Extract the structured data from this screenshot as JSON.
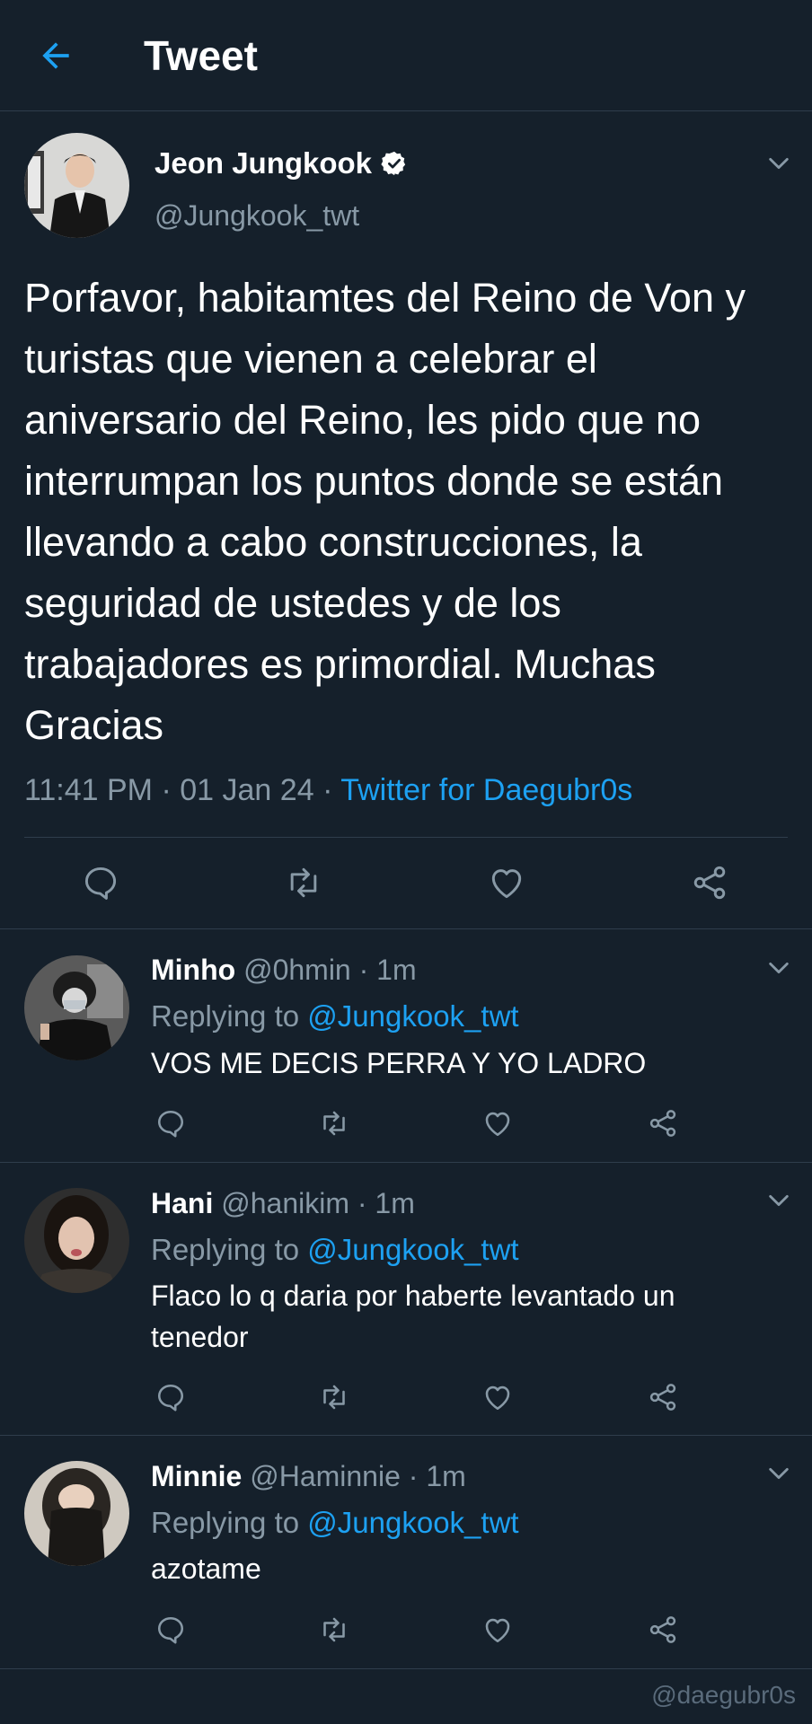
{
  "header": {
    "title": "Tweet",
    "back_icon": "back-arrow-icon"
  },
  "tweet": {
    "author_name": "Jeon Jungkook",
    "author_handle": "@Jungkook_twt",
    "verified": true,
    "text": "Porfavor, habitamtes del Reino de Von y turistas que vienen a celebrar el aniversario del Reino, les pido que no interrumpan los puntos donde se están llevando a cabo construcciones, la seguridad de ustedes y de los trabajadores es primordial. Muchas Gracias",
    "time": "11:41 PM",
    "date": "01 Jan 24",
    "source": "Twitter for Daegubr0s"
  },
  "replies": [
    {
      "name": "Minho",
      "handle": "@0hmin",
      "time": "1m",
      "replying_prefix": "Replying to",
      "replying_to": "@Jungkook_twt",
      "text": "VOS ME DECIS PERRA Y YO LADRO"
    },
    {
      "name": "Hani",
      "handle": "@hanikim",
      "time": "1m",
      "replying_prefix": "Replying to",
      "replying_to": "@Jungkook_twt",
      "text": "Flaco lo q daria por haberte levantado un tenedor"
    },
    {
      "name": "Minnie",
      "handle": "@Haminnie",
      "time": "1m",
      "replying_prefix": "Replying to",
      "replying_to": "@Jungkook_twt",
      "text": "azotame"
    }
  ],
  "watermark": "@daegubr0s",
  "colors": {
    "background": "#15202b",
    "accent": "#1da1f2",
    "muted": "#8899a6",
    "divider": "#2f3d4c"
  }
}
